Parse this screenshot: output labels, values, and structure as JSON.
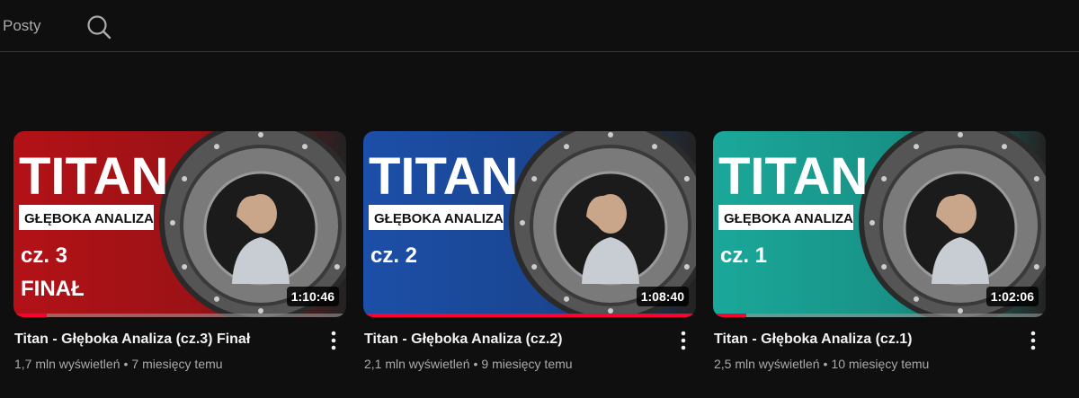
{
  "header": {
    "tab_label": "Posty",
    "search_icon": "search-icon"
  },
  "videos": [
    {
      "thumb_heading": "TITAN",
      "thumb_subtitle": "GŁĘBOKA ANALIZA",
      "thumb_part": "cz. 3",
      "thumb_extra": "FINAŁ",
      "duration": "1:10:46",
      "title": "Titan - Głęboka Analiza (cz.3) Finał",
      "views": "1,7 mln wyświetleń",
      "age": "7 miesięcy temu",
      "watched_fraction": 0.1,
      "theme_color": "#b31217"
    },
    {
      "thumb_heading": "TITAN",
      "thumb_subtitle": "GŁĘBOKA ANALIZA",
      "thumb_part": "cz. 2",
      "thumb_extra": "",
      "duration": "1:08:40",
      "title": "Titan - Głęboka Analiza (cz.2)",
      "views": "2,1 mln wyświetleń",
      "age": "9 miesięcy temu",
      "watched_fraction": 1.0,
      "theme_color": "#1c4fa8"
    },
    {
      "thumb_heading": "TITAN",
      "thumb_subtitle": "GŁĘBOKA ANALIZA",
      "thumb_part": "cz. 1",
      "thumb_extra": "",
      "duration": "1:02:06",
      "title": "Titan - Głęboka Analiza (cz.1)",
      "views": "2,5 mln wyświetleń",
      "age": "10 miesięcy temu",
      "watched_fraction": 0.1,
      "theme_color": "#1aa89a"
    }
  ],
  "colors": {
    "background": "#0f0f0f",
    "progress": "#ff0033",
    "secondary_text": "#aaaaaa"
  }
}
